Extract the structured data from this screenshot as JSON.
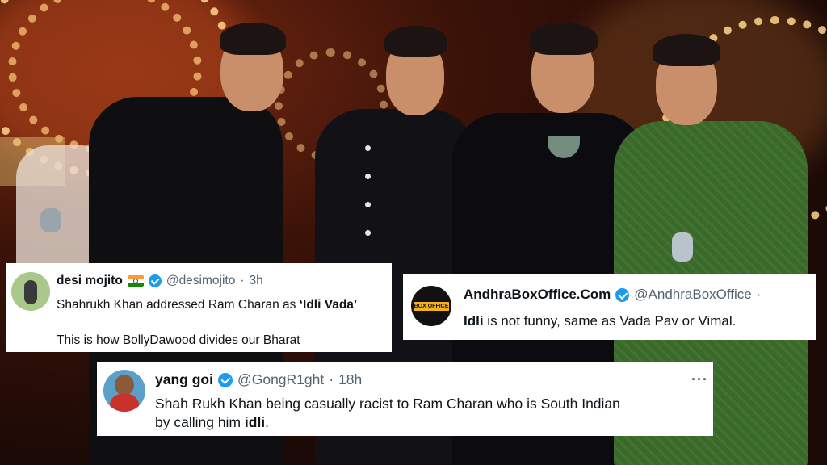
{
  "colors": {
    "verified": "#1d9bf0",
    "card_bg": "#ffffff",
    "handle": "#536471"
  },
  "tweets": [
    {
      "name": "desi mojito",
      "handle": "@desimojito",
      "time": "3h",
      "flag": "india-flag-icon",
      "line1_pre": "Shahrukh Khan addressed Ram Charan as ",
      "line1_bold": "‘Idli Vada’",
      "line2": "This is how BollyDawood divides our Bharat"
    },
    {
      "name": "AndhraBoxOffice.Com",
      "handle": "@AndhraBoxOffice",
      "time": "·",
      "avatar_text": "BOX OFFICE",
      "line1_bold": "Idli",
      "line1_post": " is not funny, same as Vada Pav or Vimal."
    },
    {
      "name": "yang goi",
      "handle": "@GongR1ght",
      "time": "18h",
      "more": "···",
      "line1": "Shah Rukh Khan being casually racist to Ram Charan who is South Indian",
      "line2_pre": "by calling him ",
      "line2_bold": "idli",
      "line2_post": "."
    }
  ]
}
